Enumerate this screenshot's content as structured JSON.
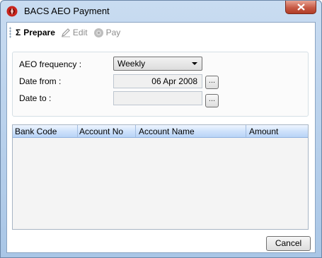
{
  "window": {
    "title": "BACS AEO Payment",
    "close_glyph": "X"
  },
  "toolbar": {
    "prepare_glyph": "Σ",
    "prepare_label": "Prepare",
    "edit_label": "Edit",
    "pay_label": "Pay"
  },
  "form": {
    "frequency_label": "AEO frequency :",
    "frequency_value": "Weekly",
    "date_from_label": "Date from :",
    "date_from_value": "06 Apr 2008",
    "date_to_label": "Date to :",
    "date_to_value": "",
    "browse_label": "..."
  },
  "grid": {
    "columns": [
      "Bank Code",
      "Account No",
      "Account Name",
      "Amount"
    ],
    "rows": []
  },
  "footer": {
    "cancel_label": "Cancel"
  },
  "colors": {
    "title_bg": "#c9dcf1",
    "close_red": "#c75a45",
    "header_blue": "#cfe2fb"
  }
}
